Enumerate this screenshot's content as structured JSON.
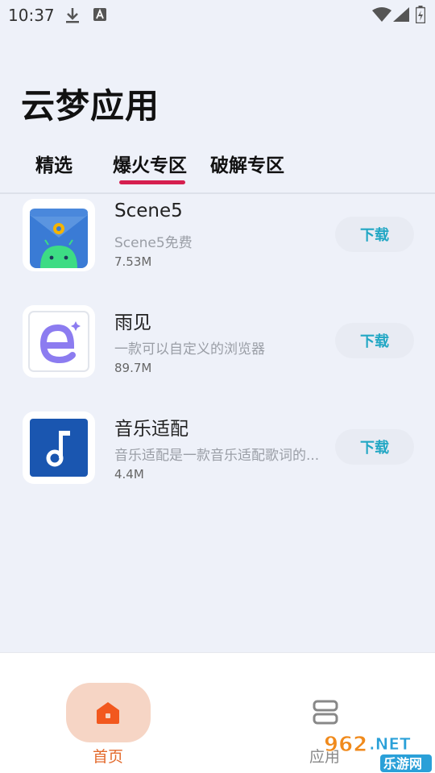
{
  "status_bar": {
    "time": "10:37",
    "left_icons": [
      "download-icon",
      "a-badge-icon"
    ],
    "right_icons": [
      "wifi-icon",
      "signal-icon",
      "battery-icon"
    ]
  },
  "header": {
    "title": "云梦应用"
  },
  "tabs": [
    {
      "label": "精选",
      "active": false
    },
    {
      "label": "爆火专区",
      "active": true
    },
    {
      "label": "破解专区",
      "active": false
    }
  ],
  "apps": [
    {
      "name": "Scene5",
      "desc": "Scene5免费",
      "size": "7.53M",
      "button": "下载",
      "icon": "scene5-android-icon"
    },
    {
      "name": "雨见",
      "desc": "一款可以自定义的浏览器",
      "size": "89.7M",
      "button": "下载",
      "icon": "browser-e-icon"
    },
    {
      "name": "音乐适配",
      "desc": "音乐适配是一款音乐适配歌词的...",
      "size": "4.4M",
      "button": "下载",
      "icon": "music-note-icon"
    }
  ],
  "bottom_nav": [
    {
      "label": "首页",
      "icon": "home-icon",
      "active": true
    },
    {
      "label": "应用",
      "icon": "apps-icon",
      "active": false
    }
  ],
  "watermark": {
    "text_top": "962.NET",
    "text_bottom": "乐游网"
  },
  "colors": {
    "accent_tab": "#d51f4f",
    "download_text": "#22a7c4",
    "nav_active": "#e36a2c",
    "background": "#eef1f9"
  }
}
